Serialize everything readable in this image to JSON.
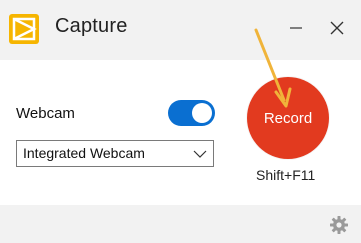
{
  "app": {
    "title": "Capture",
    "icon": "capture-app-icon",
    "colors": {
      "icon_bg": "#f6b500",
      "accent": "#0a6fd1",
      "record": "#e23a1f",
      "arrow": "#f0b43a"
    }
  },
  "window_controls": {
    "minimize_icon": "minimize-icon",
    "close_icon": "close-icon"
  },
  "webcam": {
    "label": "Webcam",
    "toggle_on": true,
    "selected_device": "Integrated Webcam"
  },
  "record": {
    "label": "Record",
    "shortcut": "Shift+F11"
  },
  "footer": {
    "settings_icon": "gear-icon"
  }
}
